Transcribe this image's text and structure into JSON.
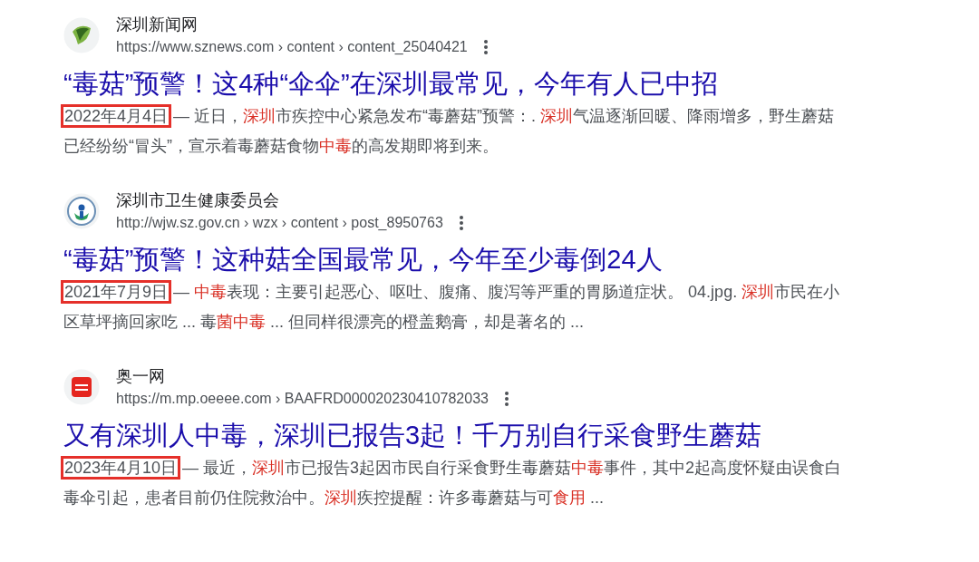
{
  "results": [
    {
      "site": "深圳新闻网",
      "logo": {
        "kind": "leaf"
      },
      "url": "https://www.sznews.com › content › content_25040421",
      "title": "“毒菇”预警！这4种“伞伞”在深圳最常见，今年有人已中招",
      "date": "2022年4月4日",
      "date_boxed": true,
      "snippet": [
        {
          "text": " — 近日，",
          "highlight": false
        },
        {
          "text": "深圳",
          "highlight": true
        },
        {
          "text": "市疾控中心紧急发布“毒蘑菇”预警：. ",
          "highlight": false
        },
        {
          "text": "深圳",
          "highlight": true
        },
        {
          "text": "气温逐渐回暖、降雨增多，野生蘑菇已经纷纷“冒头”，宣示着毒蘑菇食物",
          "highlight": false
        },
        {
          "text": "中毒",
          "highlight": true
        },
        {
          "text": "的高发期即将到来。",
          "highlight": false
        }
      ]
    },
    {
      "site": "深圳市卫生健康委员会",
      "logo": {
        "kind": "emblem"
      },
      "url": "http://wjw.sz.gov.cn › wzx › content › post_8950763",
      "title": "“毒菇”预警！这种菇全国最常见，今年至少毒倒24人",
      "date": "2021年7月9日",
      "date_boxed": true,
      "snippet": [
        {
          "text": " — ",
          "highlight": false
        },
        {
          "text": "中毒",
          "highlight": true
        },
        {
          "text": "表现：主要引起恶心、呕吐、腹痛、腹泻等严重的胃肠道症状。 04.jpg. ",
          "highlight": false
        },
        {
          "text": "深圳",
          "highlight": true
        },
        {
          "text": "市民在小区草坪摘回家吃 ... 毒",
          "highlight": false
        },
        {
          "text": "菌中毒",
          "highlight": true
        },
        {
          "text": " ... 但同样很漂亮的橙盖鹅膏，却是著名的 ...",
          "highlight": false
        }
      ]
    },
    {
      "site": "奥一网",
      "logo": {
        "kind": "red"
      },
      "url": "https://m.mp.oeeee.com › BAAFRD000020230410782033",
      "title": "又有深圳人中毒，深圳已报告3起！千万别自行采食野生蘑菇",
      "date": "2023年4月10日",
      "date_boxed": true,
      "snippet": [
        {
          "text": " — 最近，",
          "highlight": false
        },
        {
          "text": "深圳",
          "highlight": true
        },
        {
          "text": "市已报告3起因市民自行采食野生毒蘑菇",
          "highlight": false
        },
        {
          "text": "中毒",
          "highlight": true
        },
        {
          "text": "事件，其中2起高度怀疑由误食白毒伞引起，患者目前仍住院救治中。",
          "highlight": false
        },
        {
          "text": "深圳",
          "highlight": true
        },
        {
          "text": "疾控提醒：许多毒蘑菇与可",
          "highlight": false
        },
        {
          "text": "食用",
          "highlight": true
        },
        {
          "text": " ...",
          "highlight": false
        }
      ]
    }
  ]
}
